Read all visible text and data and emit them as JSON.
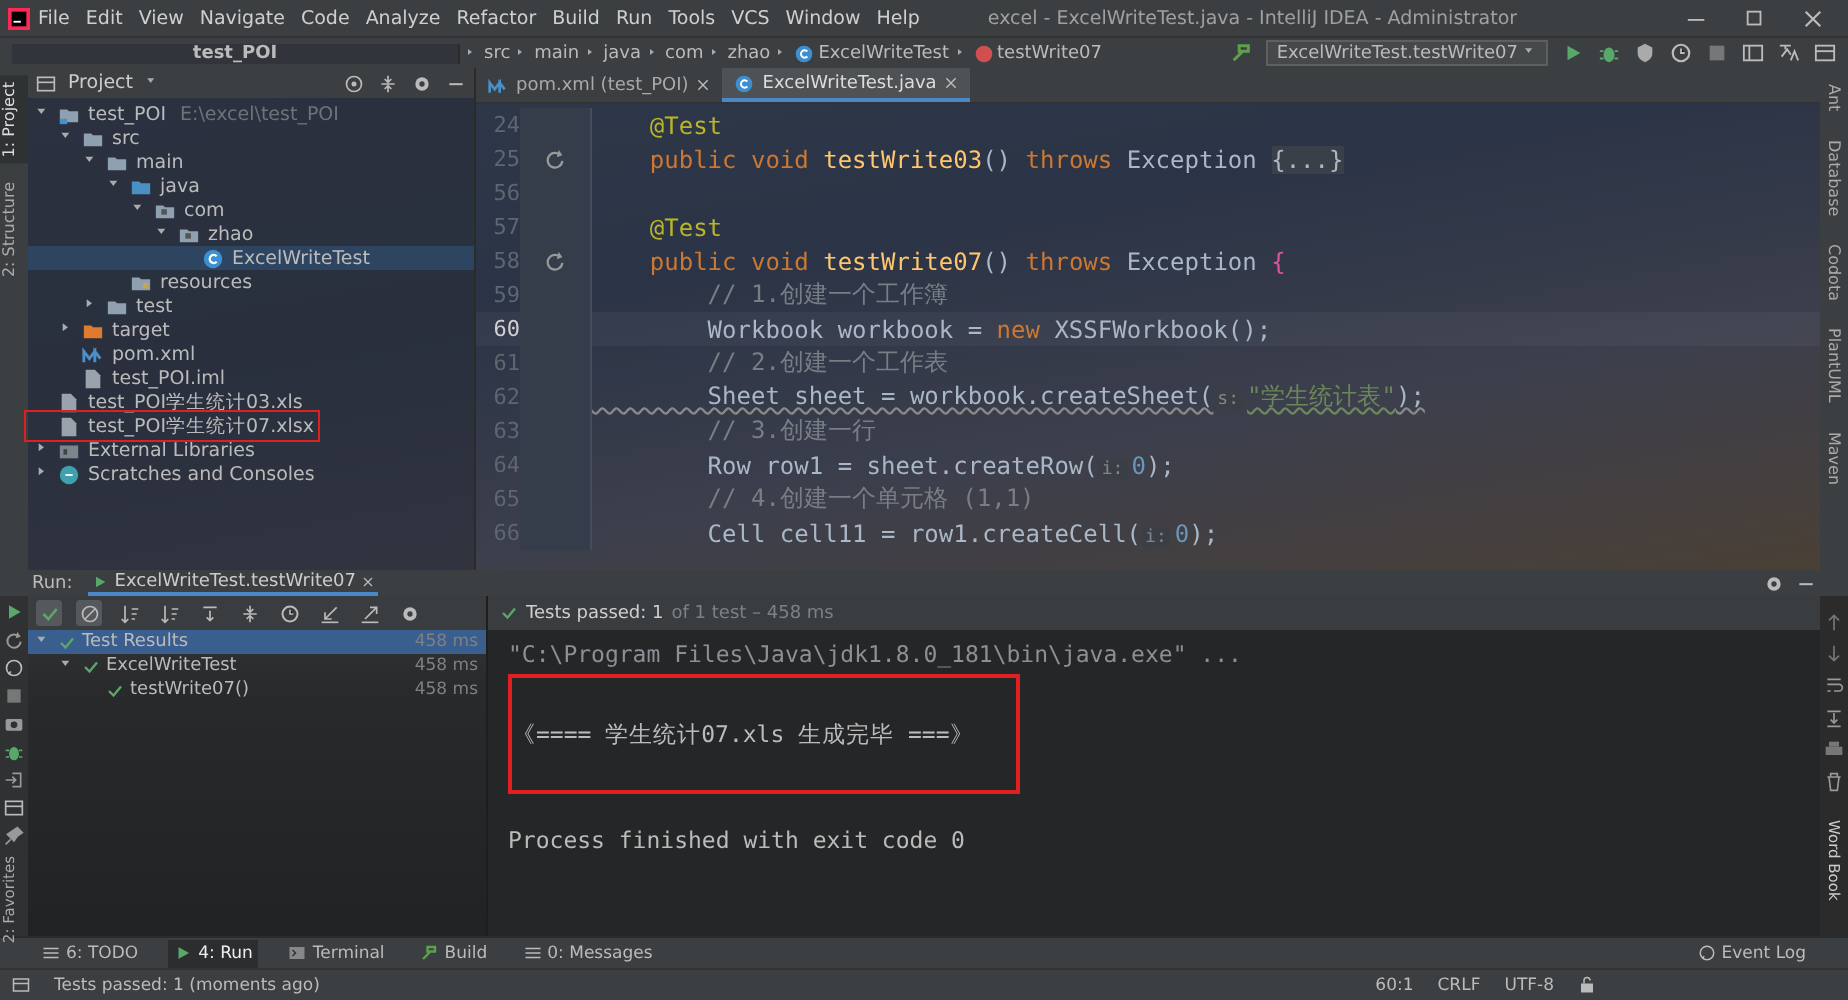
{
  "window": {
    "title": "excel - ExcelWriteTest.java - IntelliJ IDEA - Administrator"
  },
  "menu": [
    "File",
    "Edit",
    "View",
    "Navigate",
    "Code",
    "Analyze",
    "Refactor",
    "Build",
    "Run",
    "Tools",
    "VCS",
    "Window",
    "Help"
  ],
  "breadcrumbs": [
    {
      "label": "test_POI",
      "kind": "project"
    },
    {
      "label": "src",
      "kind": "plain"
    },
    {
      "label": "main",
      "kind": "plain"
    },
    {
      "label": "java",
      "kind": "plain"
    },
    {
      "label": "com",
      "kind": "plain"
    },
    {
      "label": "zhao",
      "kind": "plain"
    },
    {
      "label": "ExcelWriteTest",
      "kind": "class"
    },
    {
      "label": "testWrite07",
      "kind": "method"
    }
  ],
  "run_config": "ExcelWriteTest.testWrite07",
  "left_stripe": [
    {
      "label": "1: Project",
      "selected": true
    },
    {
      "label": "2: Structure",
      "selected": false
    }
  ],
  "project_panel": {
    "title": "Project",
    "tree": [
      {
        "label": "test_POI",
        "note": "E:\\excel\\test_POI",
        "kind": "module",
        "expanded": true,
        "selected": false,
        "highlighted": false,
        "children": [
          {
            "label": "src",
            "kind": "folder",
            "expanded": true,
            "selected": false,
            "highlighted": false,
            "children": [
              {
                "label": "main",
                "kind": "folder",
                "expanded": true,
                "selected": false,
                "highlighted": false,
                "children": [
                  {
                    "label": "java",
                    "kind": "source",
                    "expanded": true,
                    "selected": false,
                    "highlighted": false,
                    "children": [
                      {
                        "label": "com",
                        "kind": "package",
                        "expanded": true,
                        "selected": false,
                        "highlighted": false,
                        "children": [
                          {
                            "label": "zhao",
                            "kind": "package",
                            "expanded": true,
                            "selected": false,
                            "highlighted": false,
                            "children": [
                              {
                                "label": "ExcelWriteTest",
                                "kind": "class",
                                "selected": true,
                                "highlighted": false
                              }
                            ]
                          }
                        ]
                      }
                    ]
                  },
                  {
                    "label": "resources",
                    "kind": "resources",
                    "selected": false,
                    "highlighted": false
                  }
                ]
              },
              {
                "label": "test",
                "kind": "folder",
                "expanded": false,
                "selected": false,
                "highlighted": false
              }
            ]
          },
          {
            "label": "target",
            "kind": "excluded",
            "expanded": false,
            "selected": false,
            "highlighted": false
          },
          {
            "label": "pom.xml",
            "kind": "maven",
            "selected": false,
            "highlighted": false
          },
          {
            "label": "test_POI.iml",
            "kind": "file",
            "selected": false,
            "highlighted": false
          }
        ]
      },
      {
        "label": "test_POI学生统计03.xls",
        "kind": "file",
        "selected": false,
        "highlighted": false
      },
      {
        "label": "test_POI学生统计07.xlsx",
        "kind": "file",
        "selected": false,
        "highlighted": true
      },
      {
        "label": "External Libraries",
        "kind": "library",
        "expanded": false,
        "selected": false,
        "highlighted": false
      },
      {
        "label": "Scratches and Consoles",
        "kind": "scratch",
        "expanded": false,
        "selected": false,
        "highlighted": false
      }
    ]
  },
  "editor_tabs": [
    {
      "label": "pom.xml (test_POI)",
      "kind": "maven",
      "selected": false
    },
    {
      "label": "ExcelWriteTest.java",
      "kind": "class",
      "selected": true
    }
  ],
  "code": [
    {
      "number": "24",
      "current": false,
      "run_marker": false,
      "tokens": [
        {
          "kind": "annotation",
          "text": "    @Test"
        }
      ]
    },
    {
      "number": "25",
      "current": false,
      "run_marker": true,
      "tokens": [
        {
          "kind": "keyword",
          "text": "    public void "
        },
        {
          "kind": "method",
          "text": "testWrite03"
        },
        {
          "kind": "plain",
          "text": "() "
        },
        {
          "kind": "keyword",
          "text": "throws "
        },
        {
          "kind": "plain",
          "text": "Exception "
        },
        {
          "kind": "folded",
          "text": "{...}"
        }
      ]
    },
    {
      "number": "56",
      "current": false,
      "run_marker": false
    },
    {
      "number": "57",
      "current": false,
      "run_marker": false,
      "tokens": [
        {
          "kind": "annotation",
          "text": "    @Test"
        }
      ]
    },
    {
      "number": "58",
      "current": false,
      "run_marker": true,
      "tokens": [
        {
          "kind": "keyword",
          "text": "    public void "
        },
        {
          "kind": "method",
          "text": "testWrite07"
        },
        {
          "kind": "plain",
          "text": "() "
        },
        {
          "kind": "keyword",
          "text": "throws "
        },
        {
          "kind": "plain",
          "text": "Exception "
        },
        {
          "kind": "brace",
          "text": "{"
        }
      ]
    },
    {
      "number": "59",
      "current": false,
      "run_marker": false,
      "tokens": [
        {
          "kind": "comment",
          "text": "        // 1.创建一个工作簿"
        }
      ]
    },
    {
      "number": "60",
      "current": true,
      "run_marker": false,
      "tokens": [
        {
          "kind": "plain",
          "text": "        Workbook workbook = "
        },
        {
          "kind": "keyword",
          "text": "new "
        },
        {
          "kind": "plain",
          "text": "XSSFWorkbook();"
        }
      ]
    },
    {
      "number": "61",
      "current": false,
      "run_marker": false,
      "tokens": [
        {
          "kind": "comment",
          "text": "        // 2.创建一个工作表"
        }
      ]
    },
    {
      "number": "62",
      "current": false,
      "run_marker": false,
      "tokens": [
        {
          "kind": "warn",
          "text": "        Sheet sheet = workbook.createSheet("
        },
        {
          "kind": "hint",
          "text": "s:"
        },
        {
          "kind": "string",
          "text": "\"学生统计表\""
        },
        {
          "kind": "warn",
          "text": ");"
        }
      ]
    },
    {
      "number": "63",
      "current": false,
      "run_marker": false,
      "tokens": [
        {
          "kind": "comment",
          "text": "        // 3.创建一行"
        }
      ]
    },
    {
      "number": "64",
      "current": false,
      "run_marker": false,
      "tokens": [
        {
          "kind": "plain",
          "text": "        Row row1 = sheet.createRow("
        },
        {
          "kind": "hint",
          "text": "i:"
        },
        {
          "kind": "number",
          "text": "0"
        },
        {
          "kind": "plain",
          "text": ");"
        }
      ]
    },
    {
      "number": "65",
      "current": false,
      "run_marker": false,
      "tokens": [
        {
          "kind": "comment",
          "text": "        // 4.创建一个单元格 (1,1)"
        }
      ]
    },
    {
      "number": "66",
      "current": false,
      "run_marker": false,
      "tokens": [
        {
          "kind": "plain",
          "text": "        Cell cell11 = row1.createCell("
        },
        {
          "kind": "hint",
          "text": "i:"
        },
        {
          "kind": "number",
          "text": "0"
        },
        {
          "kind": "plain",
          "text": ");"
        }
      ]
    }
  ],
  "right_stripe": [
    "Ant",
    "Database",
    "Codota",
    "PlantUML",
    "Maven"
  ],
  "run_panel": {
    "label": "Run:",
    "tab": "ExcelWriteTest.testWrite07",
    "status": "Tests passed: 1",
    "status_detail": "of 1 test – 458 ms",
    "results": [
      {
        "label": "Test Results",
        "time": "458 ms",
        "selected": true,
        "children": [
          {
            "label": "ExcelWriteTest",
            "time": "458 ms",
            "selected": false,
            "children": [
              {
                "label": "testWrite07()",
                "time": "458 ms",
                "selected": false
              }
            ]
          }
        ]
      }
    ],
    "console": [
      {
        "kind": "command",
        "text": "\"C:\\Program Files\\Java\\jdk1.8.0_181\\bin\\java.exe\" ...",
        "highlighted": false
      },
      {
        "kind": "output",
        "text": "《==== 学生统计07.xls 生成完毕 ===》",
        "highlighted": true
      },
      {
        "kind": "output",
        "text": "Process finished with exit code 0",
        "highlighted": false
      }
    ]
  },
  "favorites_label": "2: Favorites",
  "word_book_label": "Word Book",
  "tool_tabs": [
    {
      "label": "6: TODO",
      "kind": "list",
      "selected": false
    },
    {
      "label": "4: Run",
      "kind": "run",
      "selected": true
    },
    {
      "label": "Terminal",
      "kind": "terminal",
      "selected": false
    },
    {
      "label": "Build",
      "kind": "hammer",
      "selected": false
    },
    {
      "label": "0: Messages",
      "kind": "list",
      "selected": false
    }
  ],
  "event_log": "Event Log",
  "status_bar": {
    "message": "Tests passed: 1 (moments ago)",
    "position": "60:1",
    "line_ending": "CRLF",
    "encoding": "UTF-8"
  }
}
